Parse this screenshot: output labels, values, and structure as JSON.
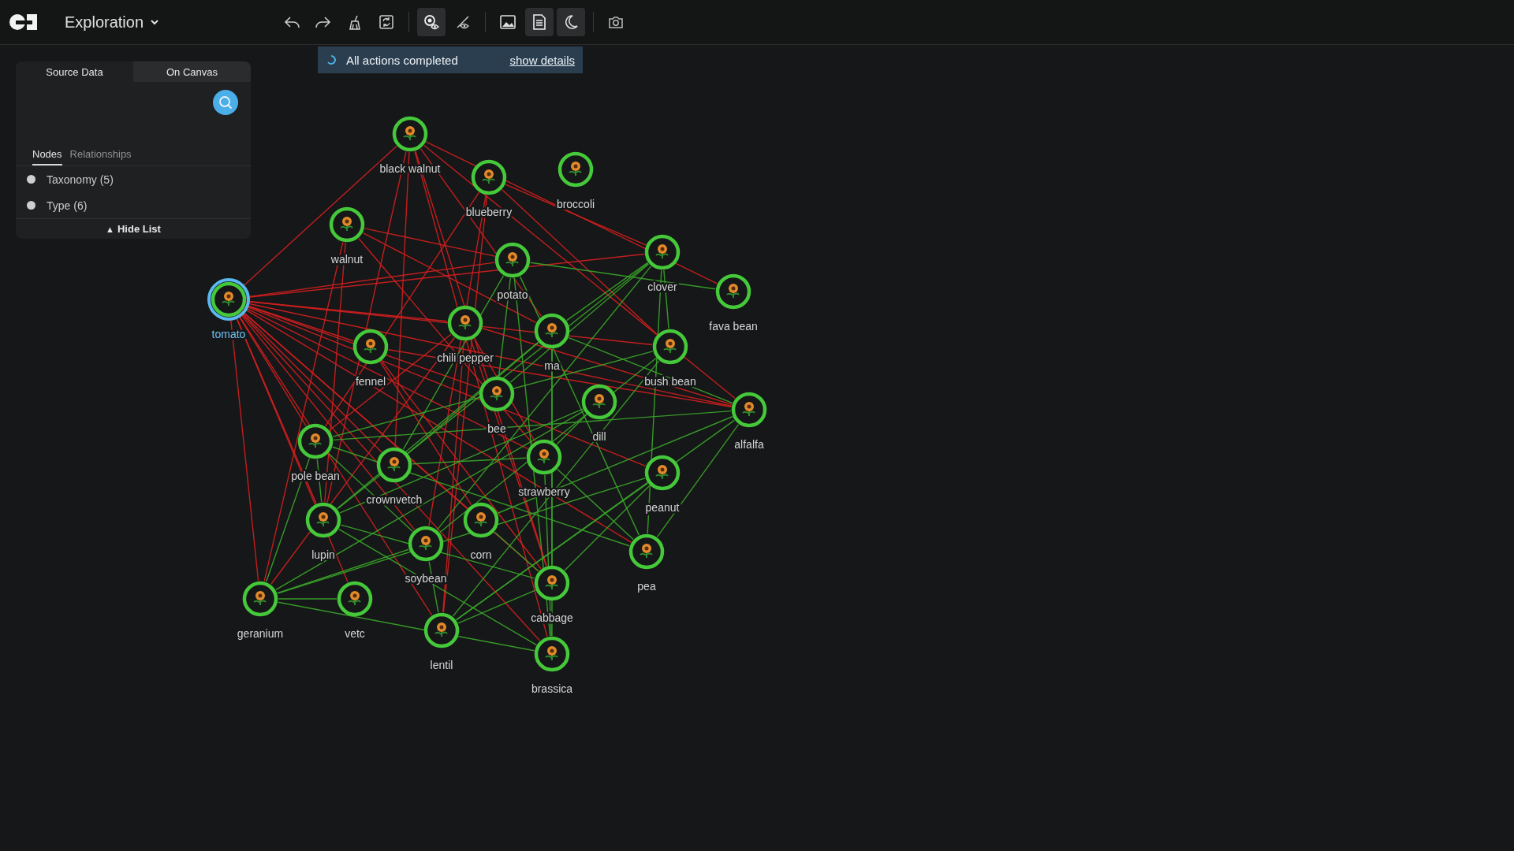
{
  "app": {
    "title": "Exploration"
  },
  "toolbar": [
    {
      "kind": "undo",
      "active": false
    },
    {
      "kind": "redo",
      "active": false
    },
    {
      "kind": "clear",
      "active": false
    },
    {
      "kind": "refresh",
      "active": false,
      "divider_after": true
    },
    {
      "kind": "reveal",
      "active": true
    },
    {
      "kind": "hide",
      "active": false,
      "divider_after": true
    },
    {
      "kind": "image",
      "active": false
    },
    {
      "kind": "document",
      "active": true
    },
    {
      "kind": "theme",
      "active": true,
      "divider_after": true
    },
    {
      "kind": "camera",
      "active": false
    }
  ],
  "toast": {
    "message": "All actions completed",
    "link": "show details"
  },
  "panel": {
    "tabs": [
      {
        "label": "Source Data",
        "selected": true
      },
      {
        "label": "On Canvas",
        "selected": false
      }
    ],
    "subtabs": [
      {
        "label": "Nodes",
        "selected": true
      },
      {
        "label": "Relationships",
        "selected": false
      }
    ],
    "items": [
      {
        "label": "Taxonomy (5)"
      },
      {
        "label": "Type (6)"
      }
    ],
    "hide_list": {
      "icon": "▲",
      "label": "Hide List"
    }
  },
  "graph": {
    "nodes": [
      {
        "label": "black walnut",
        "selected": false
      },
      {
        "label": "blueberry",
        "selected": false
      },
      {
        "label": "broccoli",
        "selected": false
      },
      {
        "label": "walnut",
        "selected": false
      },
      {
        "label": "tomato",
        "selected": true
      },
      {
        "label": "potato",
        "selected": false
      },
      {
        "label": "clover",
        "selected": false
      },
      {
        "label": "fava bean",
        "selected": false
      },
      {
        "label": "chili pepper",
        "selected": false
      },
      {
        "label": "fennel",
        "selected": false
      },
      {
        "label": "ma",
        "selected": false
      },
      {
        "label": "bush bean",
        "selected": false
      },
      {
        "label": "bee",
        "selected": false
      },
      {
        "label": "dill",
        "selected": false
      },
      {
        "label": "alfalfa",
        "selected": false
      },
      {
        "label": "strawberry",
        "selected": false
      },
      {
        "label": "pole bean",
        "selected": false
      },
      {
        "label": "crownvetch",
        "selected": false
      },
      {
        "label": "peanut",
        "selected": false
      },
      {
        "label": "corn",
        "selected": false
      },
      {
        "label": "lupin",
        "selected": false
      },
      {
        "label": "soybean",
        "selected": false
      },
      {
        "label": "pea",
        "selected": false
      },
      {
        "label": "vetc",
        "selected": false
      },
      {
        "label": "cabbage",
        "selected": false
      },
      {
        "label": "geranium",
        "selected": false
      },
      {
        "label": "lentil",
        "selected": false
      },
      {
        "label": "brassica",
        "selected": false
      }
    ]
  }
}
